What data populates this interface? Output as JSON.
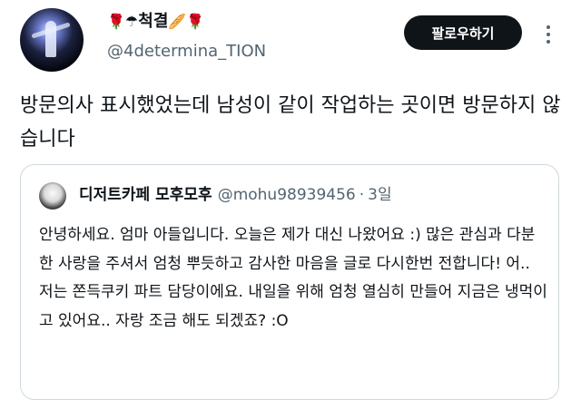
{
  "author": {
    "display_name": "척결",
    "emoji_left": "🌹☂",
    "emoji_right": "🥖🌹",
    "handle": "@4determina_TION"
  },
  "actions": {
    "follow_label": "팔로우하기"
  },
  "tweet": {
    "text": "방문의사 표시했었는데 남성이 같이 작업하는 곳이면 방문하지 않습니다"
  },
  "quoted_tweet": {
    "display_name": "디저트카페 모후모후",
    "handle": "@mohu98939456",
    "separator": "·",
    "date": "3일",
    "text": "안녕하세요. 엄마 아들입니다. 오늘은 제가 대신 나왔어요 :) 많은 관심과 다분한 사랑을 주셔서 엄청 뿌듯하고 감사한 마음을 글로 다시한번 전합니다! 어.. 저는 쫀득쿠키 파트 담당이에요. 내일을 위해 엄청 열심히 만들어 지금은 냉먹이고 있어요.. 자랑 조금 해도 되겠죠? :O"
  },
  "colors": {
    "text_primary": "#0f1419",
    "text_secondary": "#536471",
    "button_bg": "#0f1419",
    "border": "#cfd9de"
  },
  "icons": {
    "more": "more-horizontal-icon"
  }
}
